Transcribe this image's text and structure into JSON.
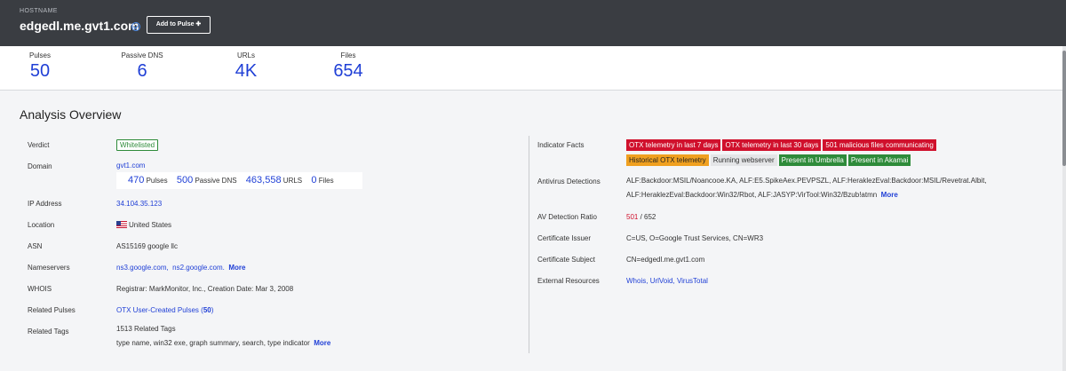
{
  "header": {
    "label": "HOSTNAME",
    "hostname": "edgedl.me.gvt1.com",
    "add_to_pulse": "Add to Pulse ✚"
  },
  "stats": [
    {
      "label": "Pulses",
      "value": "50"
    },
    {
      "label": "Passive DNS",
      "value": "6"
    },
    {
      "label": "URLs",
      "value": "4K"
    },
    {
      "label": "Files",
      "value": "654"
    }
  ],
  "overview": {
    "title": "Analysis Overview",
    "verdict": {
      "label": "Verdict",
      "value": "Whitelisted"
    },
    "domain": {
      "label": "Domain",
      "value": "gvt1.com",
      "counts": [
        {
          "num": "470",
          "unit": "Pulses"
        },
        {
          "num": "500",
          "unit": "Passive DNS"
        },
        {
          "num": "463,558",
          "unit": "URLS"
        },
        {
          "num": "0",
          "unit": "Files"
        }
      ]
    },
    "ip": {
      "label": "IP Address",
      "value": "34.104.35.123"
    },
    "location": {
      "label": "Location",
      "value": "United States"
    },
    "asn": {
      "label": "ASN",
      "value": "AS15169 google llc"
    },
    "nameservers": {
      "label": "Nameservers",
      "ns1": "ns3.google.com,",
      "ns2": "ns2.google.com.",
      "more": "More"
    },
    "whois": {
      "label": "WHOIS",
      "value": "Registrar: MarkMonitor, Inc.,  Creation Date: Mar 3, 2008"
    },
    "related_pulses": {
      "label": "Related Pulses",
      "link": "OTX User-Created Pulses (",
      "count": "50",
      "close": ")"
    },
    "related_tags": {
      "label": "Related Tags",
      "count_text": "1513 Related Tags",
      "tags": "type name,  win32 exe,  graph summary,  search,  type indicator",
      "more": "More"
    }
  },
  "right": {
    "indicator_facts": {
      "label": "Indicator Facts",
      "tags": [
        {
          "text": "OTX telemetry in last 7 days",
          "kind": "red"
        },
        {
          "text": "OTX telemetry in last 30 days",
          "kind": "red"
        },
        {
          "text": "501 malicious files communicating",
          "kind": "red"
        },
        {
          "text": "Historical OTX telemetry",
          "kind": "orange"
        },
        {
          "text": "Running webserver",
          "kind": "gray"
        },
        {
          "text": "Present in Umbrella",
          "kind": "green"
        },
        {
          "text": "Present in Akamai",
          "kind": "green"
        }
      ]
    },
    "antivirus": {
      "label": "Antivirus Detections",
      "line1": "ALF:Backdoor:MSIL/Noancooe.KA,  ALF:E5.SpikeAex.PEVPSZL,  ALF:HeraklezEval:Backdoor:MSIL/Revetrat.Albit,",
      "line2": "ALF:HeraklezEval:Backdoor:Win32/Rbot,  ALF:JASYP:VirTool:Win32/Bzub!atmn",
      "more": "More"
    },
    "av_ratio": {
      "label": "AV Detection Ratio",
      "detected": "501",
      "total": " / 652"
    },
    "cert_issuer": {
      "label": "Certificate Issuer",
      "value": "C=US, O=Google Trust Services, CN=WR3"
    },
    "cert_subject": {
      "label": "Certificate Subject",
      "value": "CN=edgedl.me.gvt1.com"
    },
    "external": {
      "label": "External Resources",
      "links": [
        "Whois,",
        "UrlVoid,",
        "VirusTotal"
      ]
    }
  },
  "colors": {
    "accent": "#1f3fd6",
    "header_bg": "#3a3d42",
    "danger": "#d0102c",
    "success": "#2e8b3a",
    "warning": "#f0a020"
  }
}
